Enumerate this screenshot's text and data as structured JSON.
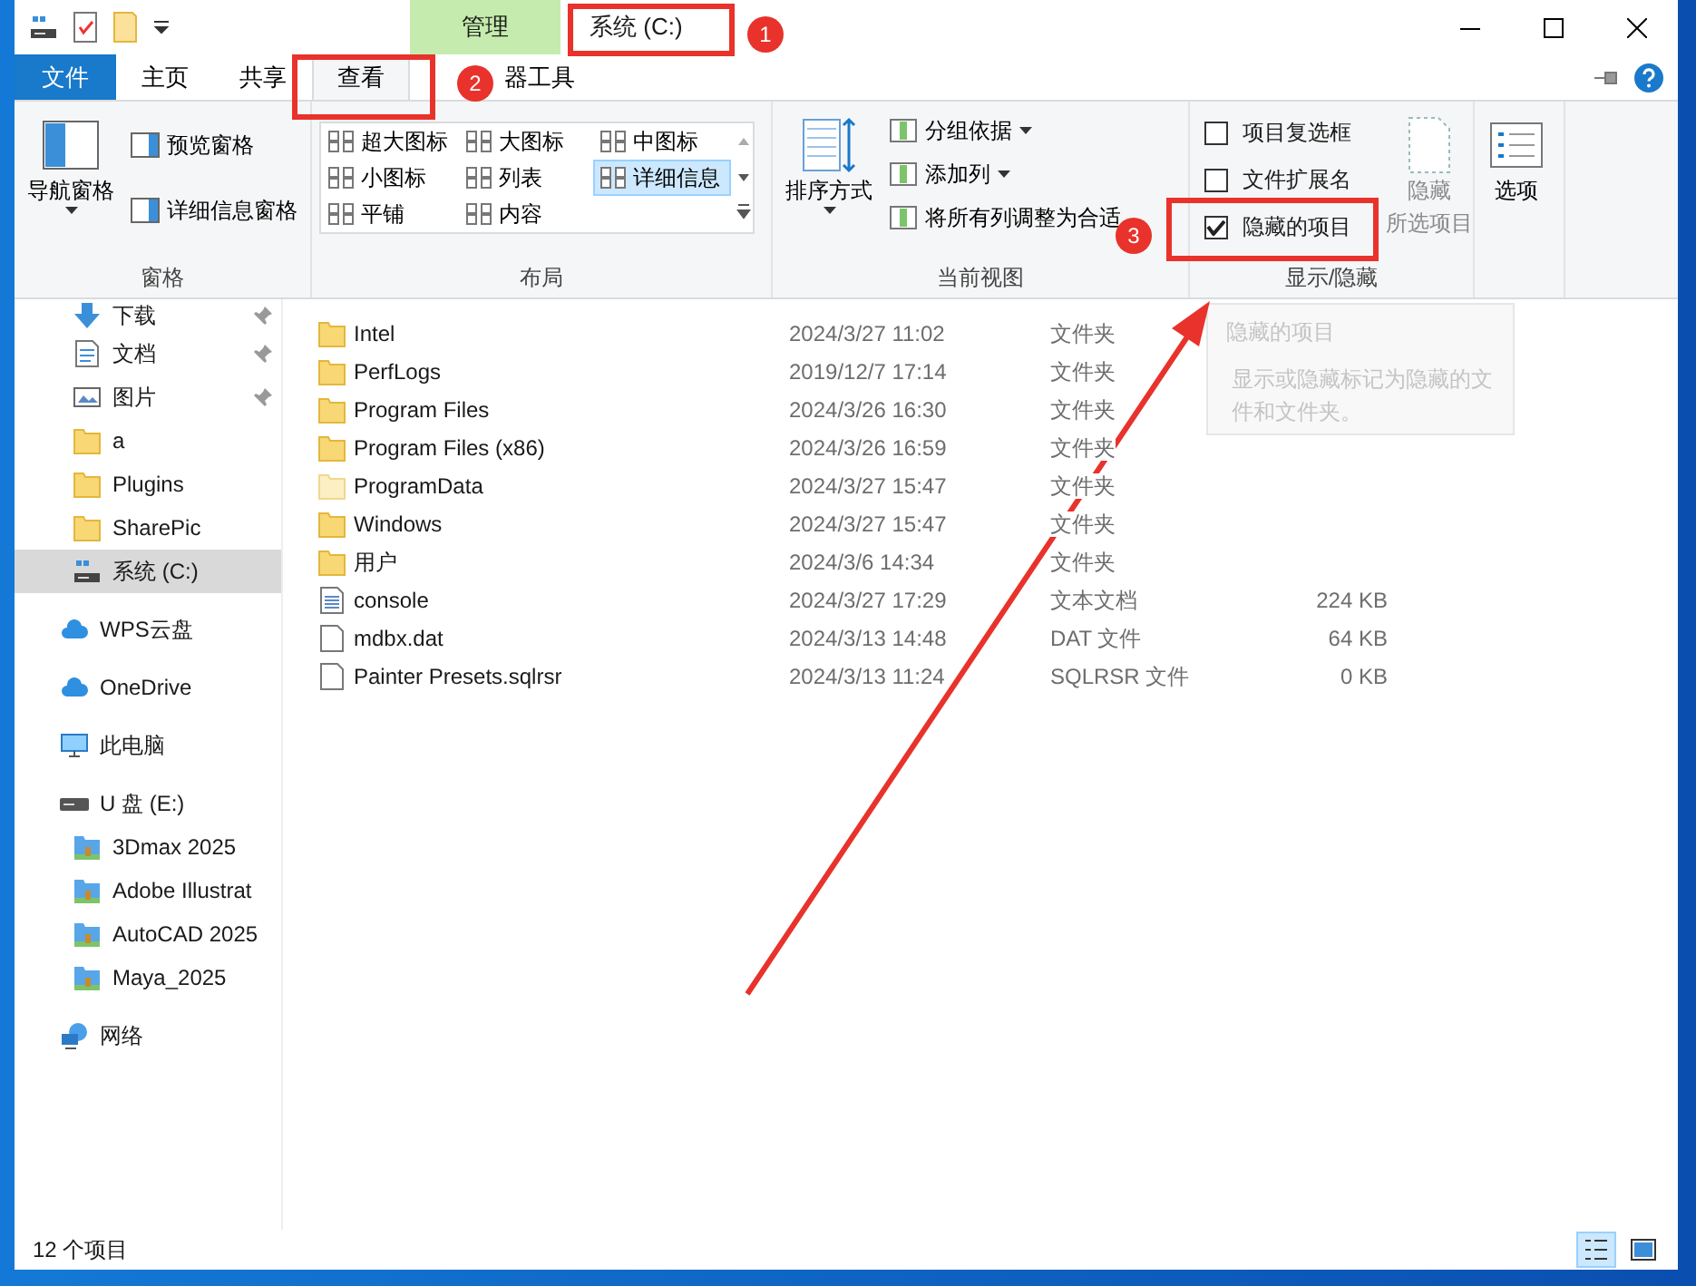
{
  "title_bar": {
    "context_tab": "管理",
    "title": "系统 (C:)"
  },
  "tabs": [
    {
      "label": "文件",
      "kind": "file",
      "selected": false
    },
    {
      "label": "主页",
      "kind": "tab",
      "selected": false
    },
    {
      "label": "共享",
      "kind": "tab",
      "selected": false
    },
    {
      "label": "查看",
      "kind": "tab",
      "selected": true
    },
    {
      "label": "器工具",
      "kind": "tab",
      "selected": false
    }
  ],
  "ribbon": {
    "panes": {
      "title": "窗格",
      "large": "导航窗格",
      "small": [
        "预览窗格",
        "详细信息窗格"
      ]
    },
    "layout": {
      "title": "布局",
      "items": [
        {
          "label": "超大图标",
          "selected": false
        },
        {
          "label": "大图标",
          "selected": false
        },
        {
          "label": "中图标",
          "selected": false
        },
        {
          "label": "小图标",
          "selected": false
        },
        {
          "label": "列表",
          "selected": false
        },
        {
          "label": "详细信息",
          "selected": true
        },
        {
          "label": "平铺",
          "selected": false
        },
        {
          "label": "内容",
          "selected": false
        }
      ]
    },
    "current_view": {
      "title": "当前视图",
      "large": "排序方式",
      "small": [
        {
          "label": "分组依据",
          "kind": "dropdown"
        },
        {
          "label": "添加列",
          "kind": "dropdown"
        },
        {
          "label": "将所有列调整为合适",
          "kind": "action"
        }
      ]
    },
    "show_hide": {
      "title": "显示/隐藏",
      "checks": [
        {
          "label": "项目复选框",
          "checked": false
        },
        {
          "label": "文件扩展名",
          "checked": false
        },
        {
          "label": "隐藏的项目",
          "checked": true
        }
      ],
      "hide_button": {
        "label": "隐藏",
        "sublabel": "所选项目",
        "disabled": true
      }
    },
    "options": {
      "label": "选项"
    }
  },
  "sidebar": {
    "quick_access": [
      {
        "label": "下载",
        "kind": "download",
        "pinned": true,
        "selected": false
      },
      {
        "label": "文档",
        "kind": "document",
        "pinned": true,
        "selected": false
      },
      {
        "label": "图片",
        "kind": "picture",
        "pinned": true,
        "selected": false
      },
      {
        "label": "a",
        "kind": "folder",
        "pinned": false,
        "selected": false
      },
      {
        "label": "Plugins",
        "kind": "folder",
        "pinned": false,
        "selected": false
      },
      {
        "label": "SharePic",
        "kind": "folder",
        "pinned": false,
        "selected": false
      },
      {
        "label": "系统 (C:)",
        "kind": "drive",
        "pinned": false,
        "selected": true
      }
    ],
    "locations": [
      {
        "label": "WPS云盘",
        "kind": "cloud"
      },
      {
        "label": "OneDrive",
        "kind": "cloud"
      },
      {
        "label": "此电脑",
        "kind": "pc"
      },
      {
        "label": "U 盘 (E:)",
        "kind": "usb",
        "children": [
          {
            "label": "3Dmax 2025",
            "kind": "shared"
          },
          {
            "label": "Adobe Illustrat",
            "kind": "shared"
          },
          {
            "label": "AutoCAD 2025",
            "kind": "shared"
          },
          {
            "label": "Maya_2025",
            "kind": "shared"
          }
        ]
      },
      {
        "label": "网络",
        "kind": "network"
      }
    ]
  },
  "files": [
    {
      "name": "Intel",
      "date": "2024/3/27 11:02",
      "type": "文件夹",
      "kind": "folder"
    },
    {
      "name": "PerfLogs",
      "date": "2019/12/7 17:14",
      "type": "文件夹",
      "kind": "folder"
    },
    {
      "name": "Program Files",
      "date": "2024/3/26 16:30",
      "type": "文件夹",
      "kind": "folder"
    },
    {
      "name": "Program Files (x86)",
      "date": "2024/3/26 16:59",
      "type": "文件夹",
      "kind": "folder"
    },
    {
      "name": "ProgramData",
      "date": "2024/3/27 15:47",
      "type": "文件夹",
      "kind": "hidden_folder"
    },
    {
      "name": "Windows",
      "date": "2024/3/27 15:47",
      "type": "文件夹",
      "kind": "folder"
    },
    {
      "name": "用户",
      "date": "2024/3/6 14:34",
      "type": "文件夹",
      "kind": "folder"
    },
    {
      "name": "console",
      "date": "2024/3/27 17:29",
      "type": "文本文档",
      "size": "224 KB",
      "kind": "text"
    },
    {
      "name": "mdbx.dat",
      "date": "2024/3/13 14:48",
      "type": "DAT 文件",
      "size": "64 KB",
      "kind": "file"
    },
    {
      "name": "Painter Presets.sqlrsr",
      "date": "2024/3/13 11:24",
      "type": "SQLRSR 文件",
      "size": "0 KB",
      "kind": "file"
    }
  ],
  "tooltip": {
    "title": "隐藏的项目",
    "text": "显示或隐藏标记为隐藏的文件和文件夹。"
  },
  "status_bar": {
    "count": "12 个项目",
    "views": [
      {
        "kind": "details",
        "selected": true
      },
      {
        "kind": "thumbnails",
        "selected": false
      }
    ]
  },
  "annotations": [
    {
      "label": "1"
    },
    {
      "label": "2"
    },
    {
      "label": "3"
    }
  ]
}
